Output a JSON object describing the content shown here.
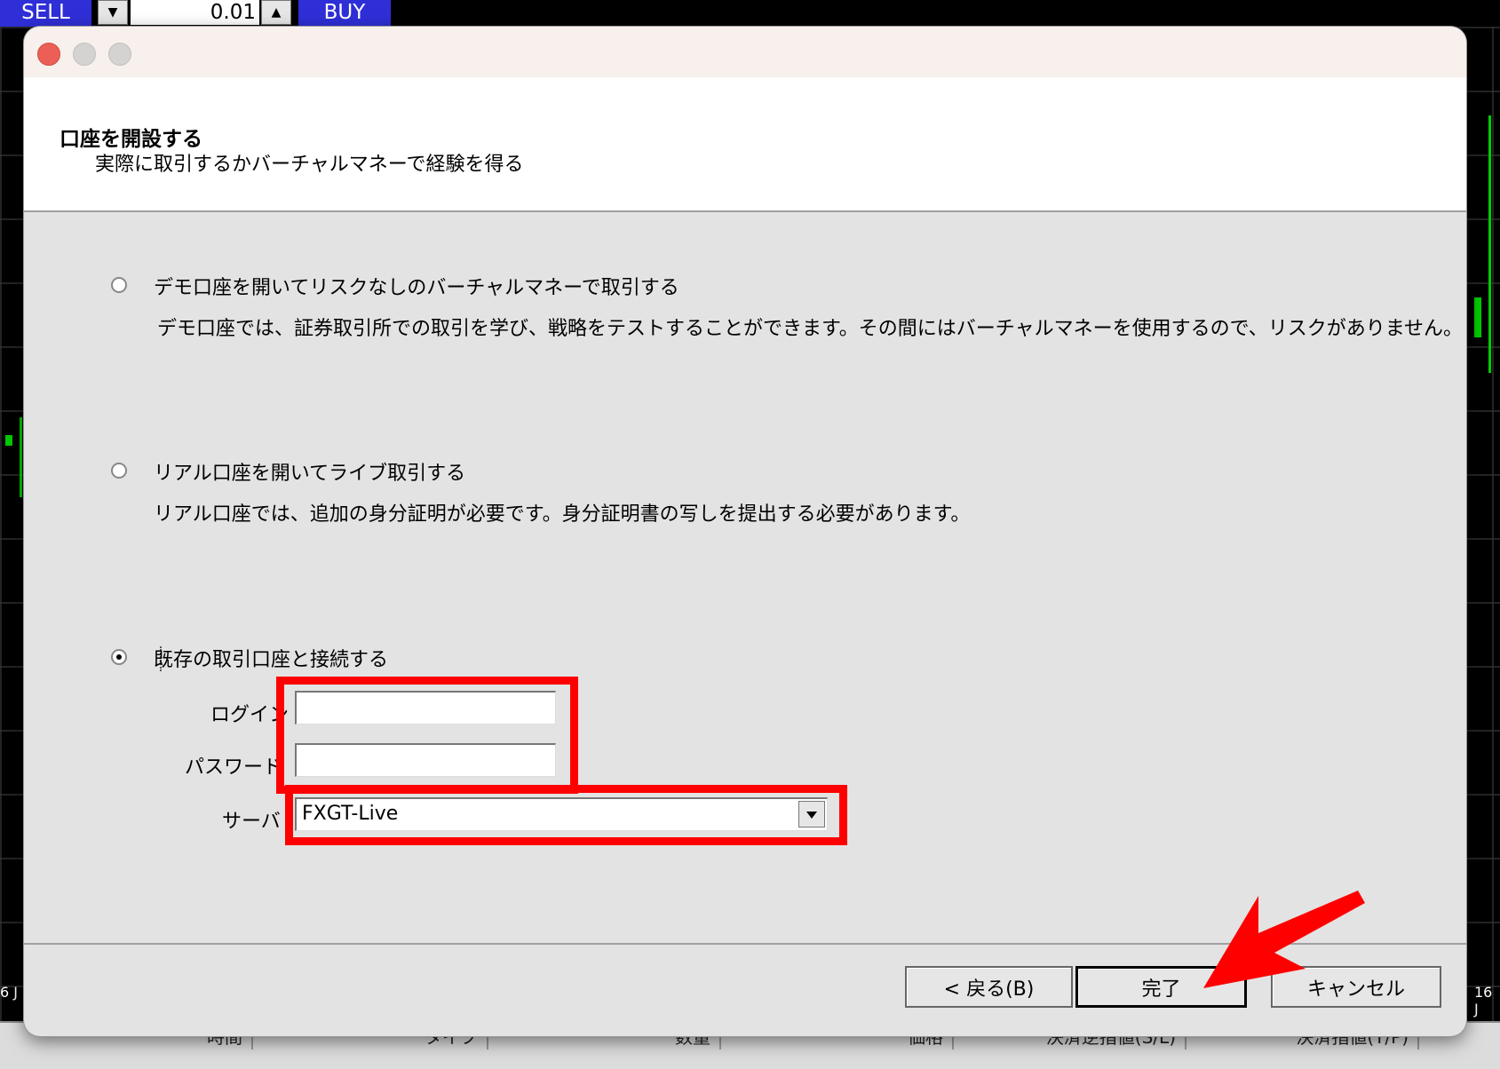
{
  "terminal": {
    "sell_label": "SELL",
    "buy_label": "BUY",
    "lot_value": "0.01",
    "date_left": "6 J",
    "date_right": "16 J",
    "table_headers": [
      "時間",
      "タイプ",
      "数量",
      "価格",
      "決済逆指値(S/L)",
      "決済指値(T/P)"
    ]
  },
  "dialog": {
    "title": "口座を開設する",
    "subtitle": "実際に取引するかバーチャルマネーで経験を得る",
    "options": [
      {
        "label": "デモ口座を開いてリスクなしのバーチャルマネーで取引する",
        "description": "デモ口座では、証券取引所での取引を学び、戦略をテストすることができます。その間にはバーチャルマネーを使用するので、リスクがありません。",
        "selected": false
      },
      {
        "label": "リアル口座を開いてライブ取引する",
        "description": "リアル口座では、追加の身分証明が必要です。身分証明書の写しを提出する必要があります。",
        "selected": false
      },
      {
        "label": "既存の取引口座と接続する",
        "description": "",
        "selected": true
      }
    ],
    "login_label": "ログイン",
    "login_value": "",
    "password_label": "パスワード",
    "password_value": "",
    "server_label": "サーバ",
    "server_value": "FXGT-Live",
    "back_button": "< 戻る(B)",
    "finish_button": "完了",
    "cancel_button": "キャンセル"
  },
  "colors": {
    "highlight": "#ff0000",
    "trade_button": "#2f2fd8",
    "close_button": "#ec5f57"
  }
}
